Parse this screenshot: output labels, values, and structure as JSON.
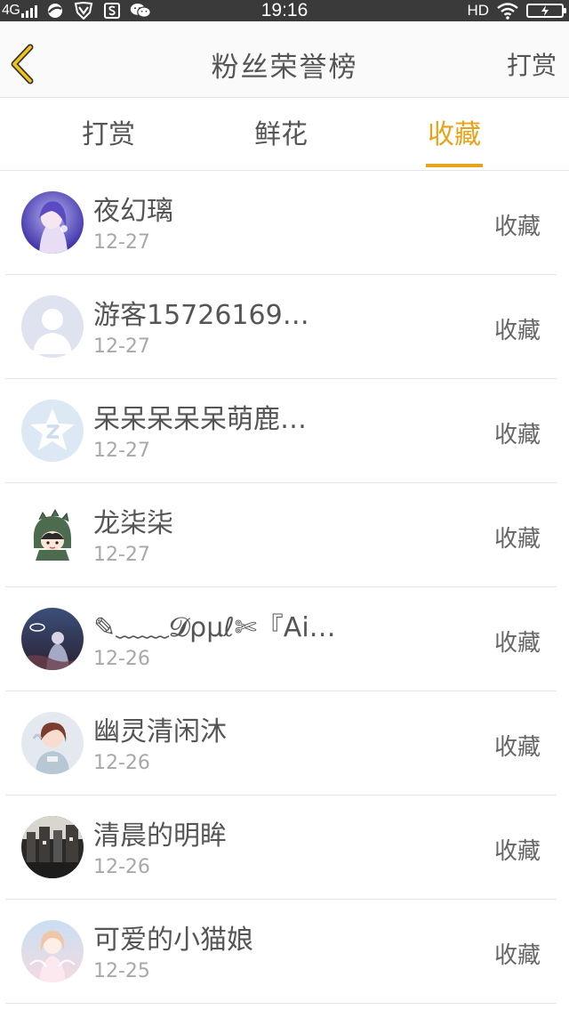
{
  "status_bar": {
    "network": "4G",
    "time": "19:16",
    "hd": "HD"
  },
  "header": {
    "title": "粉丝荣誉榜",
    "action": "打赏",
    "back_icon": "chevron-left-icon",
    "accent_color": "#f0c419"
  },
  "tabs": [
    {
      "label": "打赏",
      "active": false
    },
    {
      "label": "鲜花",
      "active": false
    },
    {
      "label": "收藏",
      "active": true
    }
  ],
  "active_color": "#e8a31a",
  "fans": [
    {
      "name": "夜幻璃",
      "date": "12-27",
      "action": "收藏",
      "avatar": "anime-girl-blue"
    },
    {
      "name": "游客15726169…",
      "date": "12-27",
      "action": "收藏",
      "avatar": "default-user-silhouette"
    },
    {
      "name": "呆呆呆呆呆萌鹿…",
      "date": "12-27",
      "action": "收藏",
      "avatar": "qzone-star-logo"
    },
    {
      "name": "龙柒柒",
      "date": "12-27",
      "action": "收藏",
      "avatar": "dino-hood-cartoon"
    },
    {
      "name": "✎﹏﹏𝓓ρμℓ✄『Ai…",
      "date": "12-26",
      "action": "收藏",
      "avatar": "dark-night-scene"
    },
    {
      "name": "幽灵清闲沐",
      "date": "12-26",
      "action": "收藏",
      "avatar": "anime-girl-hoodie"
    },
    {
      "name": "清晨的明眸",
      "date": "12-26",
      "action": "收藏",
      "avatar": "dark-city-photo"
    },
    {
      "name": "可爱的小猫娘",
      "date": "12-25",
      "action": "收藏",
      "avatar": "anime-girl-pastel"
    }
  ]
}
